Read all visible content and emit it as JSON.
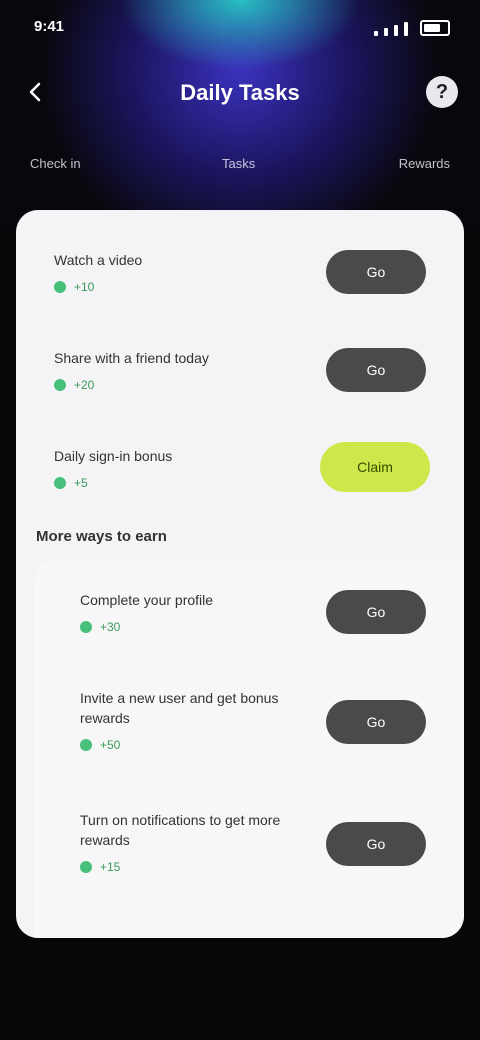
{
  "status_bar": {
    "time": "9:41"
  },
  "header": {
    "back_icon": "chevron-left-icon",
    "title": "Daily Tasks",
    "help_icon": "help-icon",
    "help_glyph": "?",
    "sub_left": "Check in",
    "sub_mid": "Tasks",
    "sub_right": "Rewards"
  },
  "tasks": [
    {
      "title": "Watch a video",
      "reward": "+10",
      "button": "Go",
      "done": false
    },
    {
      "title": "Share with a friend today",
      "reward": "+20",
      "button": "Go",
      "done": false
    },
    {
      "title": "Daily sign-in bonus",
      "reward": "+5",
      "button": "Claim",
      "done": true
    }
  ],
  "section": {
    "title": "More ways to earn"
  },
  "section_tasks": [
    {
      "title": "Complete your profile",
      "reward": "+30",
      "button": "Go"
    },
    {
      "title": "Invite a new user and get bonus rewards",
      "reward": "+50",
      "button": "Go"
    },
    {
      "title": "Turn on notifications to get more rewards",
      "reward": "+15",
      "button": "Go"
    }
  ],
  "colors": {
    "accent_green": "#cde84a",
    "button_dark": "#4a4a4c",
    "reward_green": "#3a9a5a"
  }
}
